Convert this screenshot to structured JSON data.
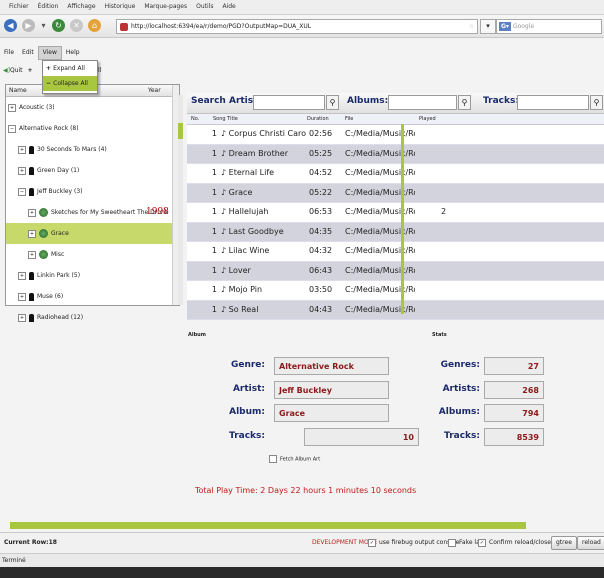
{
  "browser": {
    "menu": [
      "Fichier",
      "Édition",
      "Affichage",
      "Historique",
      "Marque-pages",
      "Outils",
      "Aide"
    ],
    "url": "http://localhost:6394/ea/r/demo/PGD?OutputMap=DUA_XUL",
    "search_engine": "G▾",
    "search_placeholder": "Google",
    "status": "Terminé"
  },
  "app": {
    "menu": [
      "File",
      "Edit",
      "View",
      "Help"
    ],
    "view_menu_items": [
      "Expand All",
      "Collapse All"
    ],
    "toolbar": {
      "quit": "Quit",
      "collapse_partial": "pse All"
    },
    "tree": {
      "col_name": "Name",
      "col_year": "Year",
      "rows": [
        {
          "label": "Acoustic (3)",
          "level": 0,
          "kind": "genre",
          "toggle": "⊞"
        },
        {
          "label": "Alternative Rock (8)",
          "level": 0,
          "kind": "genre",
          "toggle": "⊟"
        },
        {
          "label": "30 Seconds To Mars (4)",
          "level": 1,
          "kind": "artist",
          "toggle": "⊞"
        },
        {
          "label": "Green Day (1)",
          "level": 1,
          "kind": "artist",
          "toggle": "⊞"
        },
        {
          "label": "Jeff Buckley (3)",
          "level": 1,
          "kind": "artist",
          "toggle": "⊟"
        },
        {
          "label": "Sketches for My Sweetheart The Drunk",
          "level": 2,
          "kind": "album",
          "toggle": "⊞",
          "year": "1998"
        },
        {
          "label": "Grace",
          "level": 2,
          "kind": "album",
          "toggle": "⊞",
          "selected": true
        },
        {
          "label": "Misc",
          "level": 2,
          "kind": "album",
          "toggle": "⊞"
        },
        {
          "label": "Linkin Park (5)",
          "level": 1,
          "kind": "artist",
          "toggle": "⊞"
        },
        {
          "label": "Muse (6)",
          "level": 1,
          "kind": "artist",
          "toggle": "⊞"
        },
        {
          "label": "Radiohead (12)",
          "level": 1,
          "kind": "artist",
          "toggle": "⊞"
        }
      ]
    },
    "search": {
      "artist_label": "Search Artist:",
      "albums_label": "Albums:",
      "tracks_label": "Tracks:",
      "artist_value": "",
      "albums_value": "",
      "tracks_value": ""
    },
    "grid": {
      "columns": [
        "No.",
        "Song Title",
        "Duration",
        "File",
        "Played"
      ],
      "rows": [
        {
          "no": "1",
          "title": "♪ Corpus Christi Caro",
          "duration": "02:56",
          "file": "C:/Media/Music/Rocl",
          "played": ""
        },
        {
          "no": "1",
          "title": "♪ Dream Brother",
          "duration": "05:25",
          "file": "C:/Media/Music/Rocl",
          "played": ""
        },
        {
          "no": "1",
          "title": "♪ Eternal Life",
          "duration": "04:52",
          "file": "C:/Media/Music/Rocl",
          "played": ""
        },
        {
          "no": "1",
          "title": "♪ Grace",
          "duration": "05:22",
          "file": "C:/Media/Music/Rocl",
          "played": ""
        },
        {
          "no": "1",
          "title": "♪ Hallelujah",
          "duration": "06:53",
          "file": "C:/Media/Music/Rocl",
          "played": "2"
        },
        {
          "no": "1",
          "title": "♪ Last Goodbye",
          "duration": "04:35",
          "file": "C:/Media/Music/Rocl",
          "played": ""
        },
        {
          "no": "1",
          "title": "♪ Lilac Wine",
          "duration": "04:32",
          "file": "C:/Media/Music/Rocl",
          "played": ""
        },
        {
          "no": "1",
          "title": "♪ Lover",
          "duration": "06:43",
          "file": "C:/Media/Music/Rocl",
          "played": ""
        },
        {
          "no": "1",
          "title": "♪ Mojo Pin",
          "duration": "03:50",
          "file": "C:/Media/Music/Rocl",
          "played": ""
        },
        {
          "no": "1",
          "title": "♪ So Real",
          "duration": "04:43",
          "file": "C:/Media/Music/Rocl",
          "played": ""
        }
      ]
    },
    "album": {
      "section_label": "Album",
      "genre_label": "Genre:",
      "genre": "Alternative Rock",
      "artist_label": "Artist:",
      "artist": "Jeff Buckley",
      "album_label": "Album:",
      "album": "Grace",
      "tracks_label": "Tracks:",
      "tracks": "10",
      "fetch_art": "Fetch Album Art"
    },
    "stats": {
      "section_label": "Stats",
      "genres_label": "Genres:",
      "genres": "27",
      "artists_label": "Artists:",
      "artists": "268",
      "albums_label": "Albums:",
      "albums": "794",
      "tracks_label": "Tracks:",
      "tracks": "8539"
    },
    "play_time": "Total Play Time: 2 Days 22 hours 1 minutes 10 seconds",
    "statusbar": {
      "current_row": "Current Row:18",
      "dev_mode": "DEVELOPMENT MODE",
      "opt_firebug": "use firebug output console",
      "opt_fakelag": "Fake lag",
      "opt_confirm": "Confirm reload/close",
      "btn_gtree": "gtree",
      "btn_reload": "reload"
    }
  },
  "colors": {
    "accent": "#a8c640",
    "label_blue": "#1a2a6a",
    "value_red": "#8a1a1a",
    "dev_red": "#c01a1a"
  }
}
